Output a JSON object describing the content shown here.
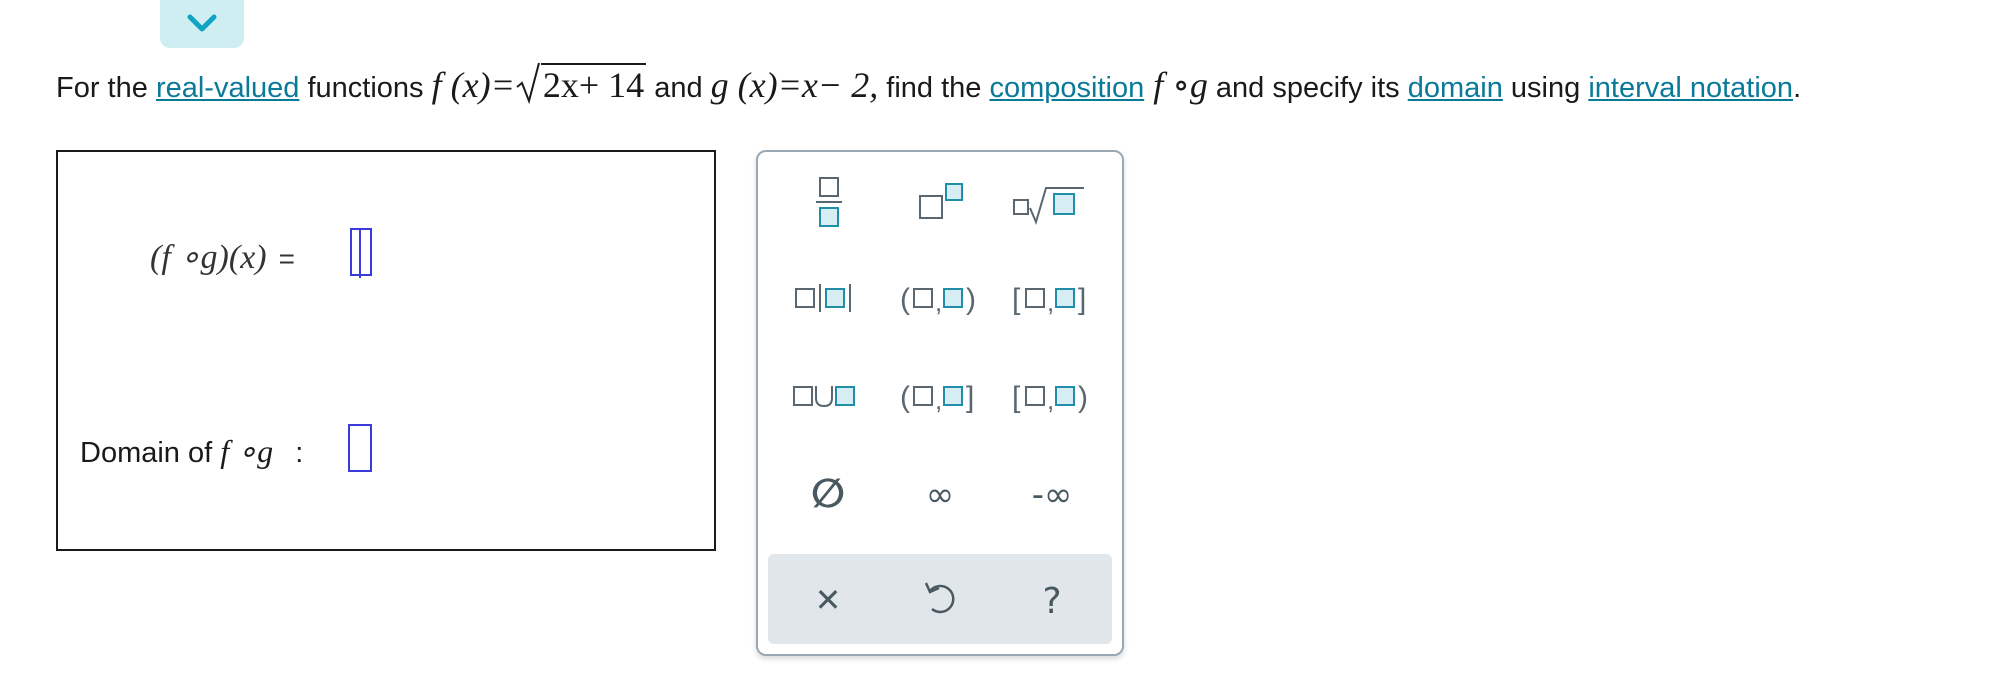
{
  "question": {
    "p1": "For the ",
    "link_real_valued": "real-valued",
    "p2": " functions ",
    "f_def_lhs": "f (x)=",
    "f_def_radicand": "2x+ 14",
    "p3": " and ",
    "g_def": "g (x)=x− 2,",
    "p4": " find the ",
    "link_composition": "composition",
    "comp_symbol": " f ∘g",
    "p5": " and specify its ",
    "link_domain": "domain",
    "p6": " using ",
    "link_interval_notation": "interval notation",
    "p7": "."
  },
  "answer": {
    "composition_label": "(f ∘g)(x)",
    "equals": "=",
    "domain_label_text": "Domain of ",
    "domain_label_math": "f ∘g",
    "colon": ":"
  },
  "palette": {
    "buttons": [
      {
        "name": "fraction-button",
        "icon": "fraction"
      },
      {
        "name": "superscript-button",
        "icon": "superscript"
      },
      {
        "name": "nth-root-button",
        "icon": "nth-root"
      },
      {
        "name": "absolute-value-button",
        "icon": "absolute-value"
      },
      {
        "name": "open-interval-button",
        "icon": "open-interval"
      },
      {
        "name": "closed-interval-button",
        "icon": "closed-interval"
      },
      {
        "name": "union-button",
        "icon": "union"
      },
      {
        "name": "left-open-interval-button",
        "icon": "left-open-interval"
      },
      {
        "name": "right-open-interval-button",
        "icon": "right-open-interval"
      },
      {
        "name": "empty-set-button",
        "icon": "empty-set"
      },
      {
        "name": "infinity-button",
        "icon": "infinity"
      },
      {
        "name": "negative-infinity-button",
        "icon": "negative-infinity"
      }
    ],
    "infinity": "∞",
    "neg_infinity": "-∞",
    "empty_set": "∅",
    "clear": "✕",
    "help": "?"
  },
  "colors": {
    "accent": "#0a7a99",
    "teal_box": "#4fb3c6",
    "input_border": "#3b3bd9",
    "palette_border": "#9aa8b3",
    "footer_bg": "#e1e6ea"
  }
}
